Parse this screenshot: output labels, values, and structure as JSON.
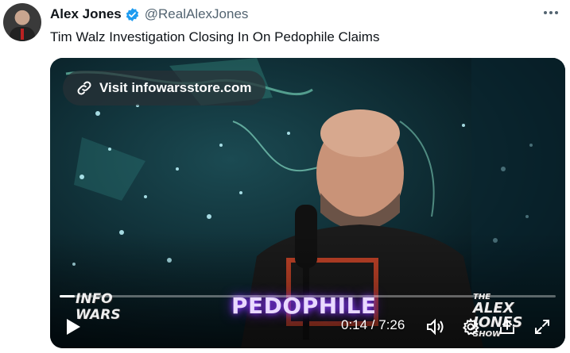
{
  "author": {
    "name": "Alex Jones",
    "handle": "@RealAlexJones",
    "verified_color": "#1d9bf0"
  },
  "tweet": {
    "text": "Tim Walz Investigation Closing In On Pedophile Claims",
    "more_icon": "more-icon"
  },
  "video": {
    "promo_link": "Visit infowarsstore.com",
    "caption": "PEDOPHILE",
    "logo_left": [
      "INFO",
      "WARS"
    ],
    "logo_right": [
      "THE",
      "ALEX",
      "JONES",
      "SHOW"
    ],
    "current_time": "0:14",
    "duration": "7:26",
    "time_display": "0:14 / 7:26",
    "progress_fraction": 0.031,
    "controls": [
      "play-icon",
      "volume-icon",
      "gear-icon",
      "share-icon",
      "fullscreen-icon"
    ]
  }
}
